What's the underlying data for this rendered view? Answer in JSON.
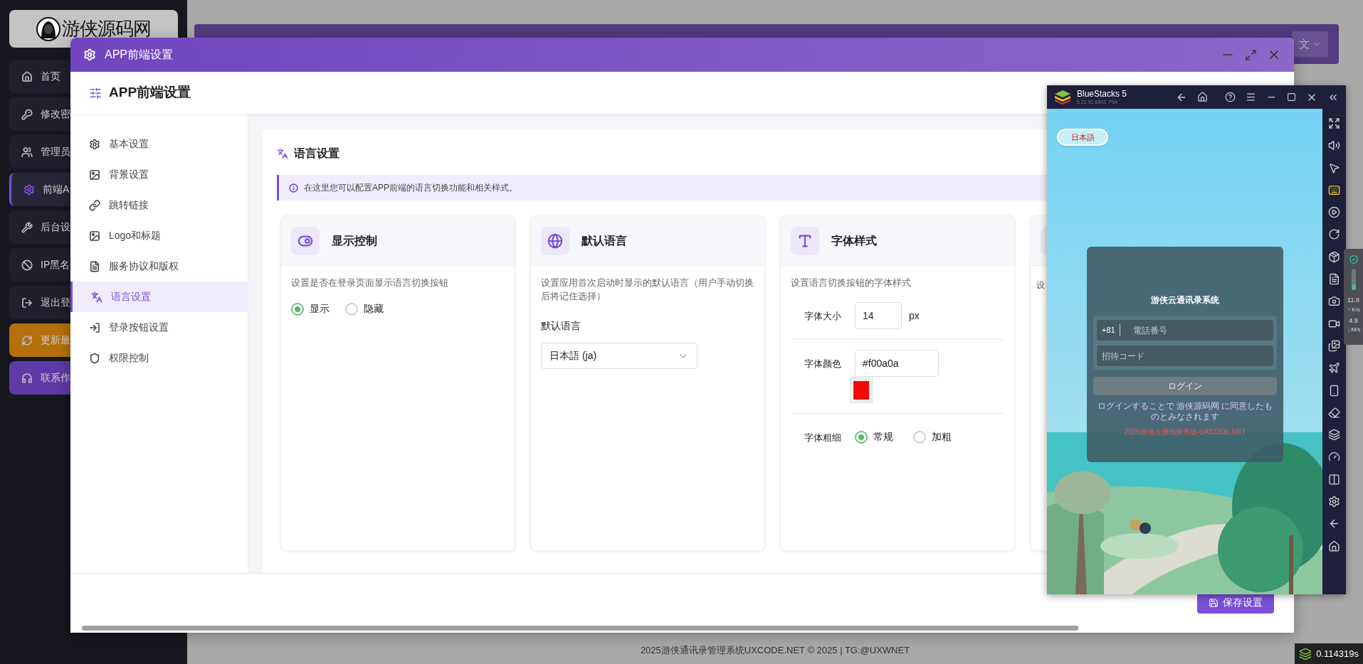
{
  "sidebar": {
    "logo": "游侠源码网",
    "items": [
      {
        "label": "首页",
        "selected": false,
        "kind": "link"
      },
      {
        "label": "修改密",
        "selected": false,
        "kind": "link"
      },
      {
        "label": "管理员",
        "selected": false,
        "kind": "link"
      },
      {
        "label": "前端A",
        "selected": true,
        "kind": "link"
      },
      {
        "label": "后台设",
        "selected": false,
        "kind": "link"
      },
      {
        "label": "IP黑名",
        "selected": false,
        "kind": "link"
      },
      {
        "label": "退出登",
        "selected": false,
        "kind": "link"
      },
      {
        "label": "更新最",
        "selected": false,
        "kind": "update"
      },
      {
        "label": "联系作",
        "selected": false,
        "kind": "contact"
      }
    ]
  },
  "top_bar": {
    "language_menu": "文"
  },
  "modal": {
    "title": "APP前端设置",
    "heading": "APP前端设置",
    "menu": [
      {
        "label": "基本设置",
        "selected": false
      },
      {
        "label": "背景设置",
        "selected": false
      },
      {
        "label": "跳转链接",
        "selected": false
      },
      {
        "label": "Logo和标题",
        "selected": false
      },
      {
        "label": "服务协议和版权",
        "selected": false
      },
      {
        "label": "语言设置",
        "selected": true
      },
      {
        "label": "登录按钮设置",
        "selected": false
      },
      {
        "label": "权限控制",
        "selected": false
      }
    ],
    "section": {
      "title": "语言设置",
      "info": "在这里您可以配置APP前端的语言切换功能和相关样式。",
      "cards": [
        {
          "kind": "radio",
          "title": "显示控制",
          "description": "设置是否在登录页面显示语言切换按钮",
          "options": [
            {
              "label": "显示",
              "selected": true
            },
            {
              "label": "隐藏",
              "selected": false
            }
          ]
        },
        {
          "kind": "select",
          "title": "默认语言",
          "description": "设置应用首次启动时显示的默认语言（用户手动切换后将记住选择）",
          "field_label": "默认语言",
          "value": "日本語 (ja)"
        },
        {
          "kind": "font",
          "title": "字体样式",
          "description": "设置语言切换按钮的字体样式",
          "rows": [
            {
              "kind": "number",
              "label": "字体大小",
              "value": "14",
              "unit": "px"
            },
            {
              "kind": "color",
              "label": "字体颜色",
              "value": "#f00a0a"
            },
            {
              "kind": "radio",
              "label": "字体粗细",
              "options": [
                {
                  "label": "常规",
                  "selected": true
                },
                {
                  "label": "加粗",
                  "selected": false
                }
              ]
            }
          ]
        },
        {
          "kind": "partial",
          "description": "设"
        }
      ]
    },
    "save_button": "保存设置"
  },
  "footer": {
    "copyright": "2025游侠通讯录管理系统UXCODE.NET © 2025 | TG:@UXWNET",
    "timer": "0.114319s"
  },
  "emulator": {
    "title": "BlueStacks 5",
    "version": "5.22.91.6503  P64",
    "app": {
      "language_button": "日本語",
      "title": "游侠云通讯录系统",
      "country_code": "+81",
      "phone_placeholder": "電話番号",
      "invite_placeholder": "招待コード",
      "login_button": "ログイン",
      "agreement": "ログインすることで 游侠源码网 に同意したものとみなされます",
      "copyright": "2025游侠云通讯录系统-UXCODE.NET"
    },
    "network": {
      "upload": "11.8",
      "upload_unit": "K/s",
      "download": "4.9",
      "download_unit": "M/s"
    }
  }
}
